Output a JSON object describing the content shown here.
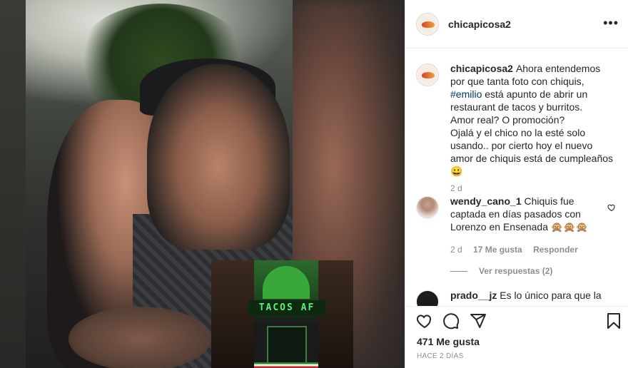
{
  "post": {
    "username": "chicapicosa2",
    "more_label": "•••",
    "inset_sign": "TACOS AF"
  },
  "caption": {
    "username": "chicapicosa2",
    "text_1": "Ahora entendemos por que tanta foto con chiquis,",
    "hashtag": "#emilio",
    "text_2": "está apunto de abrir un restaurant de tacos y burritos.",
    "text_3": "Amor real? O promoción?",
    "text_4": "Ojalá y el chico no la esté solo usando.. por cierto hoy el nuevo amor de chiquis está de cumpleaños 😀",
    "time": "2 d"
  },
  "comments": [
    {
      "username": "wendy_cano_1",
      "text": "Chiquis fue captada en días pasados con Lorenzo en Ensenada 🙊🙊🙊",
      "time": "2 d",
      "likes": "17 Me gusta",
      "reply_label": "Responder",
      "view_replies": "Ver respuestas (2)"
    },
    {
      "username": "prado__jz",
      "text": "Es lo único para que la"
    }
  ],
  "actions": {
    "likes": "471 Me gusta",
    "date": "HACE 2 DÍAS"
  },
  "icons": {
    "like": "heart-icon",
    "comment": "comment-icon",
    "share": "share-icon",
    "save": "bookmark-icon",
    "more": "more-options-icon"
  }
}
